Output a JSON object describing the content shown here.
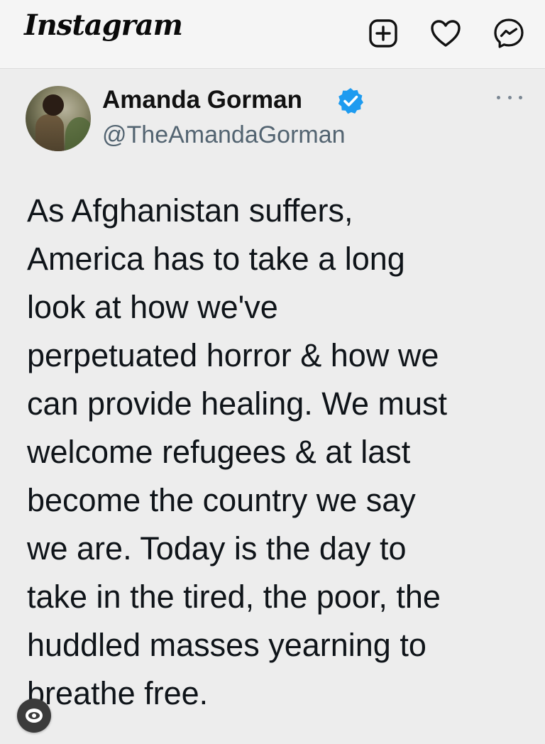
{
  "app": {
    "logo_text": "Instagram"
  },
  "topbar": {
    "icons": [
      "add-post-icon",
      "heart-icon",
      "messenger-icon"
    ]
  },
  "tweet": {
    "author_name": "Amanda Gorman",
    "handle": "@TheAmandaGorman",
    "verified": true,
    "text": "As Afghanistan suffers,\nAmerica has to take a long\nlook at how we've\nperpetuated horror & how we\ncan provide healing. We must\nwelcome refugees & at last\nbecome the country we say\nwe are. Today is the day to\ntake in the tired, the poor, the\nhuddled masses yearning to\nbreathe free.",
    "more_icon": "more-dots-icon"
  },
  "overlay": {
    "badge_icon": "eye-icon"
  },
  "colors": {
    "background": "#ededed",
    "verified_blue": "#1d9bf0",
    "handle_gray": "#536471"
  }
}
